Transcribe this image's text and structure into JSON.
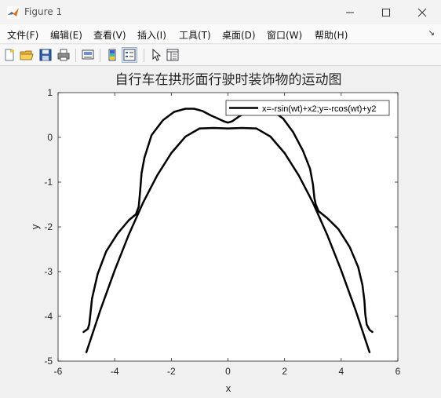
{
  "window": {
    "title": "Figure 1",
    "icon": "matlab-logo-icon"
  },
  "menu": {
    "items": [
      "文件(F)",
      "编辑(E)",
      "查看(V)",
      "插入(I)",
      "工具(T)",
      "桌面(D)",
      "窗口(W)",
      "帮助(H)"
    ],
    "overflow_arrow": "↘"
  },
  "toolbar": {
    "buttons": [
      "new-figure-icon",
      "open-file-icon",
      "save-icon",
      "print-icon",
      "link-plot-icon",
      "insert-colorbar-icon",
      "insert-legend-icon",
      "edit-plot-icon",
      "property-inspector-icon"
    ]
  },
  "chart_data": {
    "type": "line",
    "title": "自行车在拱形面行驶时装饰物的运动图",
    "xlabel": "x",
    "ylabel": "y",
    "xlim": [
      -6,
      6
    ],
    "ylim": [
      -5,
      1
    ],
    "xticks": [
      "-6",
      "-4",
      "-2",
      "0",
      "2",
      "4",
      "6"
    ],
    "yticks": [
      "1",
      "0",
      "-1",
      "-2",
      "-3",
      "-4",
      "-5"
    ],
    "grid": false,
    "legend": {
      "placement": "top-right",
      "entries": [
        "x=-rsin(wt)+x2;y=-rcos(wt)+y2"
      ]
    },
    "line_color": "#000000",
    "series": [
      {
        "name": "x=-rsin(wt)+x2;y=-rcos(wt)+y2",
        "x": [
          -5.1,
          -4.95,
          -4.9,
          -4.85,
          -4.8,
          -4.6,
          -4.3,
          -3.9,
          -3.5,
          -3.25,
          -3.15,
          -3.1,
          -3.05,
          -2.95,
          -2.7,
          -2.3,
          -1.9,
          -1.5,
          -1.2,
          -0.9,
          -0.6,
          -0.35,
          -0.15,
          0.0,
          0.15,
          0.4,
          0.7,
          1.0,
          1.3,
          1.6,
          1.95,
          2.3,
          2.65,
          2.9,
          3.0,
          3.05,
          3.1,
          3.2,
          3.5,
          3.9,
          4.3,
          4.6,
          4.75,
          4.82,
          4.85,
          4.9,
          5.0,
          5.1
        ],
        "y": [
          -4.35,
          -4.28,
          -4.18,
          -3.9,
          -3.6,
          -3.05,
          -2.55,
          -2.15,
          -1.85,
          -1.72,
          -1.55,
          -1.2,
          -0.8,
          -0.45,
          0.05,
          0.38,
          0.57,
          0.64,
          0.64,
          0.59,
          0.49,
          0.42,
          0.36,
          0.33,
          0.36,
          0.47,
          0.58,
          0.65,
          0.64,
          0.58,
          0.42,
          0.12,
          -0.3,
          -0.7,
          -1.05,
          -1.35,
          -1.5,
          -1.65,
          -1.8,
          -2.05,
          -2.45,
          -2.9,
          -3.3,
          -3.65,
          -3.95,
          -4.18,
          -4.3,
          -4.35
        ]
      },
      {
        "name": "",
        "x": [
          -5.0,
          -4.5,
          -4.0,
          -3.5,
          -3.0,
          -2.5,
          -2.0,
          -1.5,
          -1.0,
          -0.5,
          0.0,
          0.5,
          1.0,
          1.5,
          2.0,
          2.5,
          3.0,
          3.5,
          4.0,
          4.5,
          5.0
        ],
        "y": [
          -4.8,
          -3.85,
          -2.97,
          -2.17,
          -1.46,
          -0.85,
          -0.35,
          0.02,
          0.2,
          0.21,
          0.2,
          0.21,
          0.2,
          0.02,
          -0.35,
          -0.85,
          -1.46,
          -2.17,
          -2.97,
          -3.85,
          -4.8
        ]
      }
    ]
  }
}
